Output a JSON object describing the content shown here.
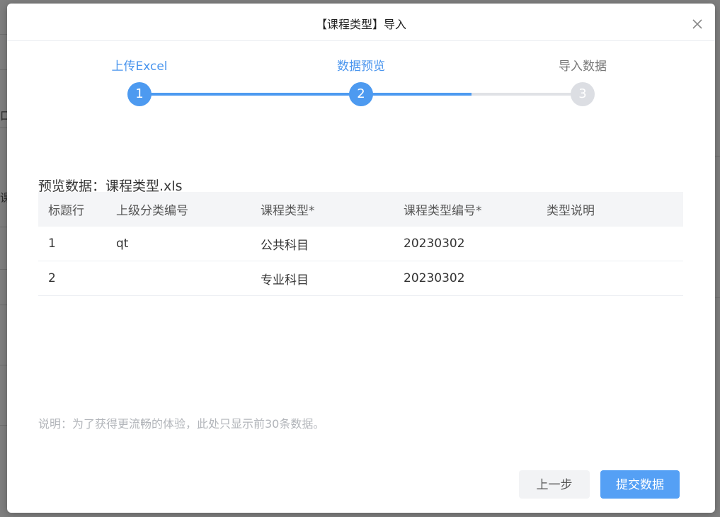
{
  "dialog": {
    "title": "【课程类型】导入"
  },
  "steps": [
    {
      "number": "1",
      "label": "上传Excel",
      "state": "active"
    },
    {
      "number": "2",
      "label": "数据预览",
      "state": "active"
    },
    {
      "number": "3",
      "label": "导入数据",
      "state": "pending"
    }
  ],
  "preview": {
    "title": "预览数据：课程类型.xls",
    "columns": [
      "标题行",
      "上级分类编号",
      "课程类型*",
      "课程类型编号*",
      "类型说明"
    ],
    "rows": [
      [
        "1",
        "qt",
        "公共科目",
        "20230302",
        ""
      ],
      [
        "2",
        "",
        "专业科目",
        "20230302",
        ""
      ]
    ]
  },
  "note": "说明：为了获得更流畅的体验，此处只显示前30条数据。",
  "buttons": {
    "prev": "上一步",
    "submit": "提交数据"
  },
  "colors": {
    "accent": "#4d9af0",
    "pending": "#dcdee3",
    "submit_bg": "#55a0f5"
  },
  "icons": {
    "close": "close-icon"
  }
}
